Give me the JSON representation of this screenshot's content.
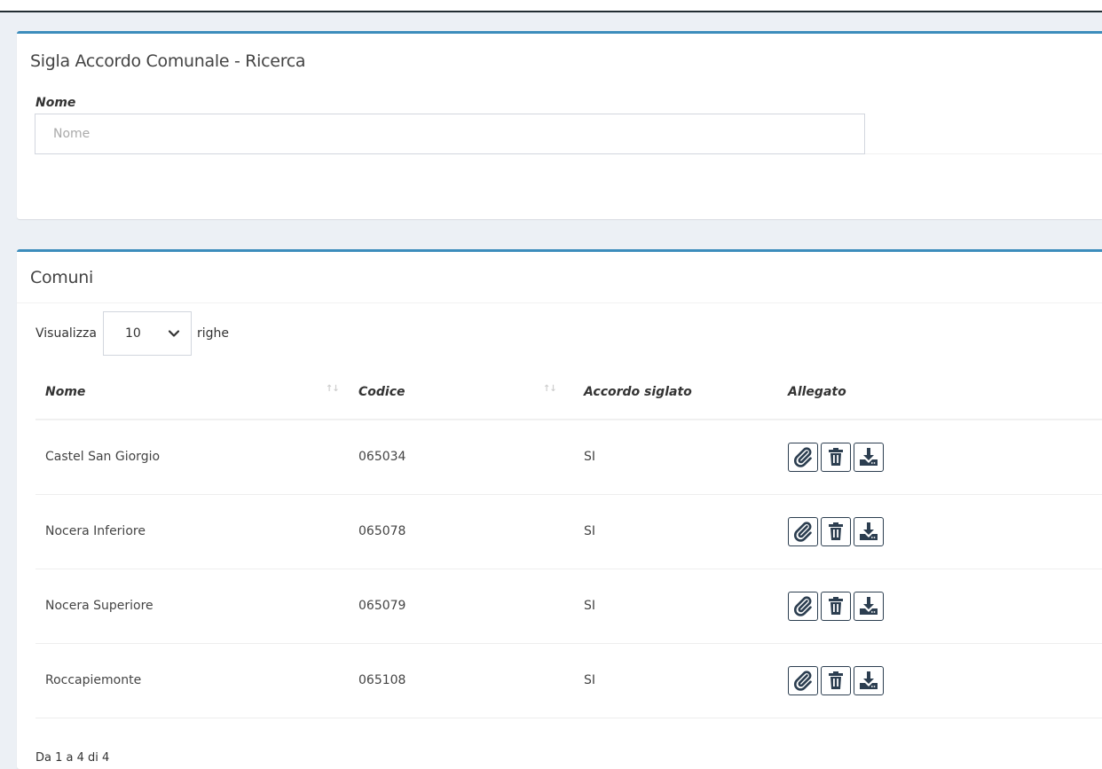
{
  "search_box": {
    "title": "Sigla Accordo Comunale - Ricerca",
    "nome_label": "Nome",
    "nome_placeholder": "Nome",
    "nome_value": ""
  },
  "list_box": {
    "title": "Comuni",
    "length_prefix": "Visualizza",
    "length_value": "10",
    "length_suffix": "righe",
    "columns": [
      "Nome",
      "Codice",
      "Accordo siglato",
      "Allegato"
    ],
    "rows": [
      {
        "nome": "Castel San Giorgio",
        "codice": "065034",
        "accordo": "SI"
      },
      {
        "nome": "Nocera Inferiore",
        "codice": "065078",
        "accordo": "SI"
      },
      {
        "nome": "Nocera Superiore",
        "codice": "065079",
        "accordo": "SI"
      },
      {
        "nome": "Roccapiemonte",
        "codice": "065108",
        "accordo": "SI"
      }
    ],
    "action_icons": [
      "paperclip-icon",
      "trash-icon",
      "download-icon"
    ],
    "info": "Da 1 a 4 di 4"
  },
  "colors": {
    "accent": "#3c8dbc",
    "background": "#ecf0f5",
    "icon": "#2c3e50"
  }
}
